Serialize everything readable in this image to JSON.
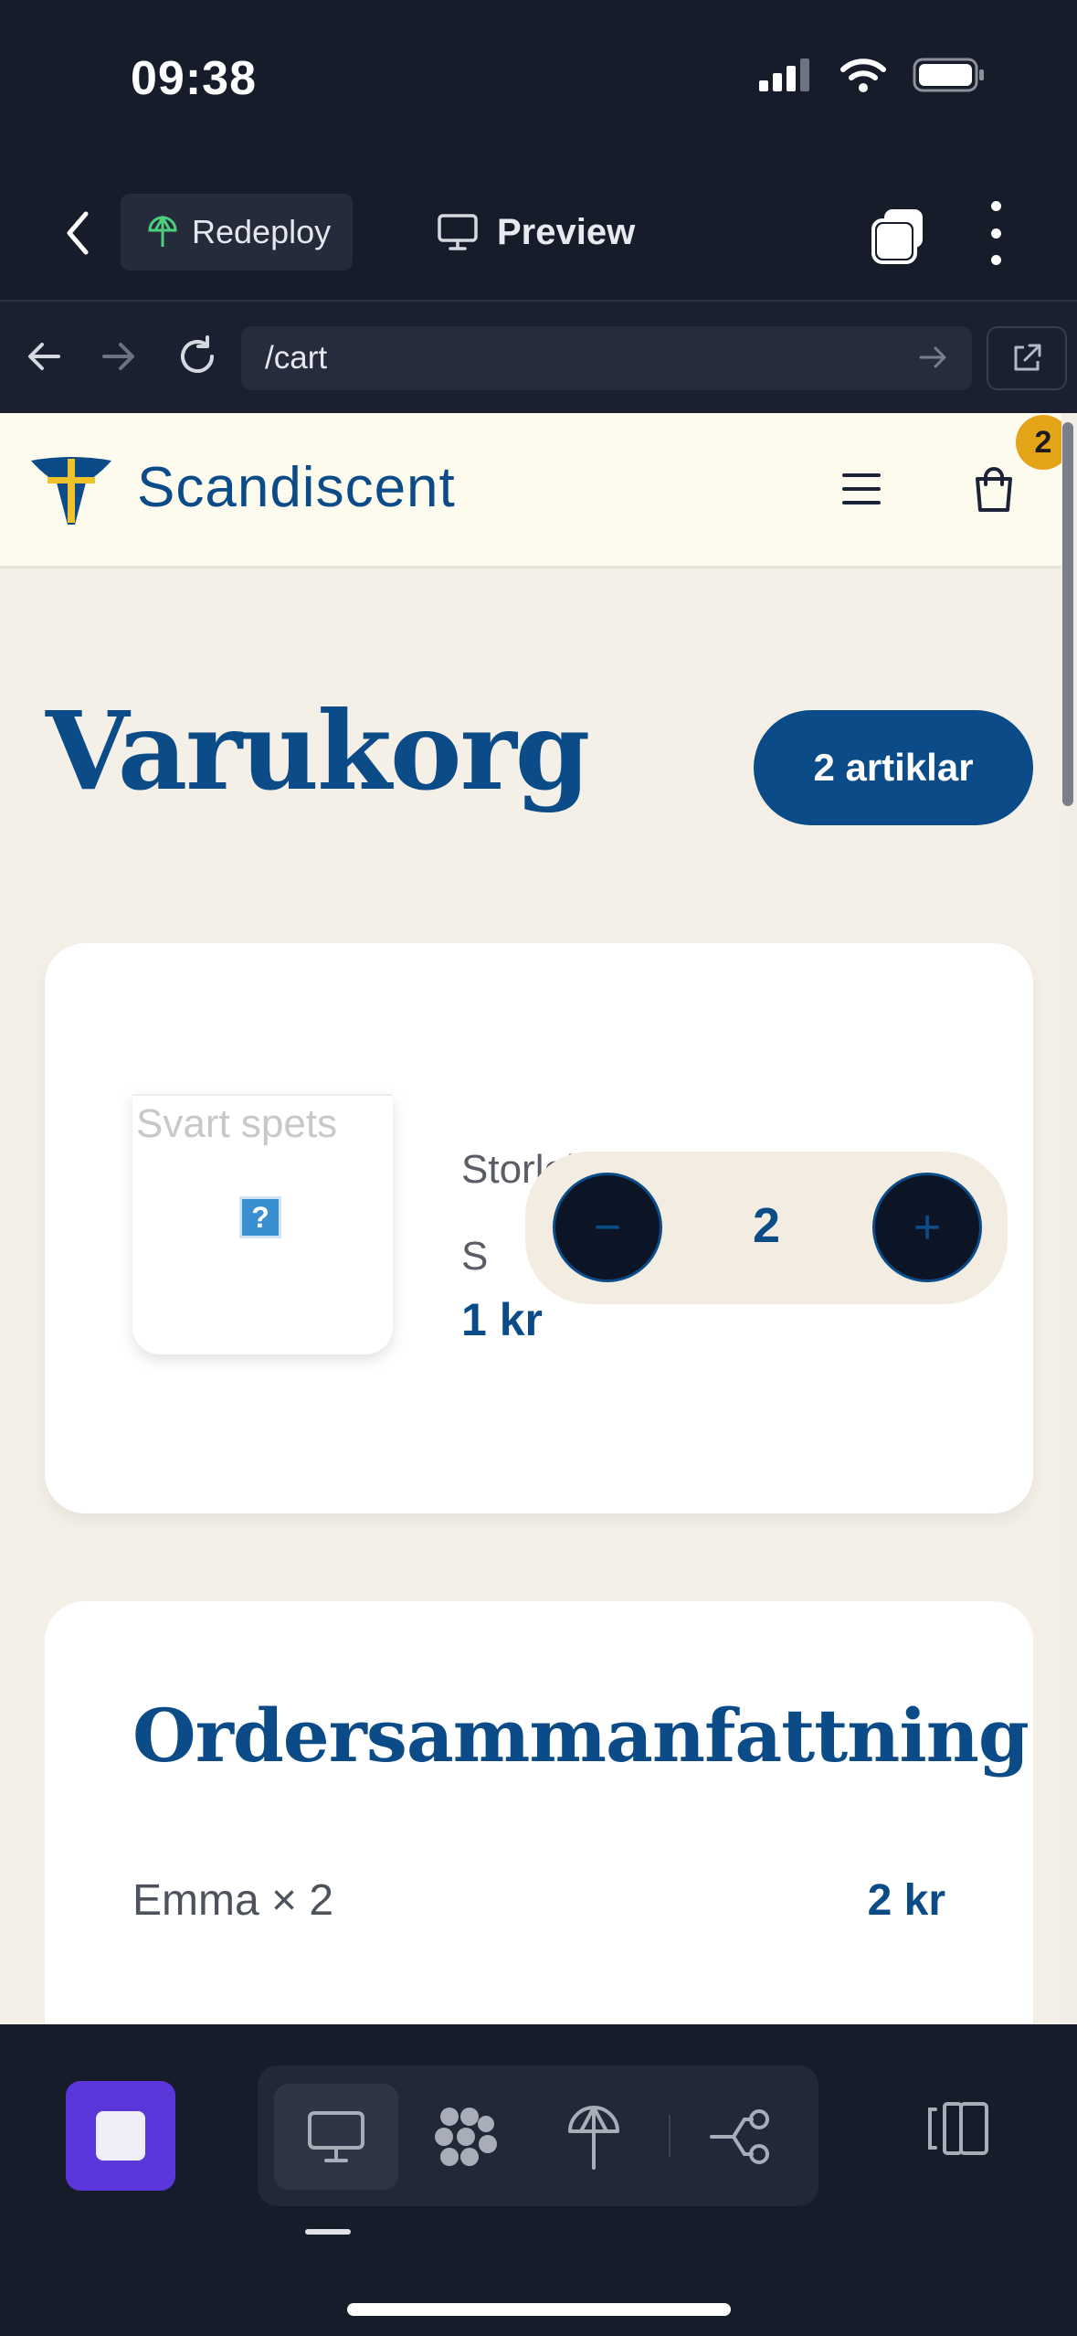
{
  "status_bar": {
    "time": "09:38"
  },
  "ide": {
    "redeploy_label": "Redeploy",
    "preview_label": "Preview",
    "url": "/cart"
  },
  "site": {
    "name": "Scandiscent",
    "cart_count": "2",
    "page_title": "Varukorg",
    "items_count_label": "2 artiklar",
    "cart_item": {
      "image_alt": "Svart spets",
      "size_label": "Storlek: S",
      "price": "1 kr",
      "quantity": "2",
      "decrement_symbol": "−",
      "increment_symbol": "+"
    },
    "summary": {
      "title": "Ordersammanfattning",
      "line_item": "Emma × 2",
      "line_amount": "2 kr"
    }
  },
  "colors": {
    "brand_blue": "#0b4b87",
    "badge_gold": "#e3a418",
    "stop_purple": "#5a36db",
    "ide_background": "#171c2b"
  }
}
